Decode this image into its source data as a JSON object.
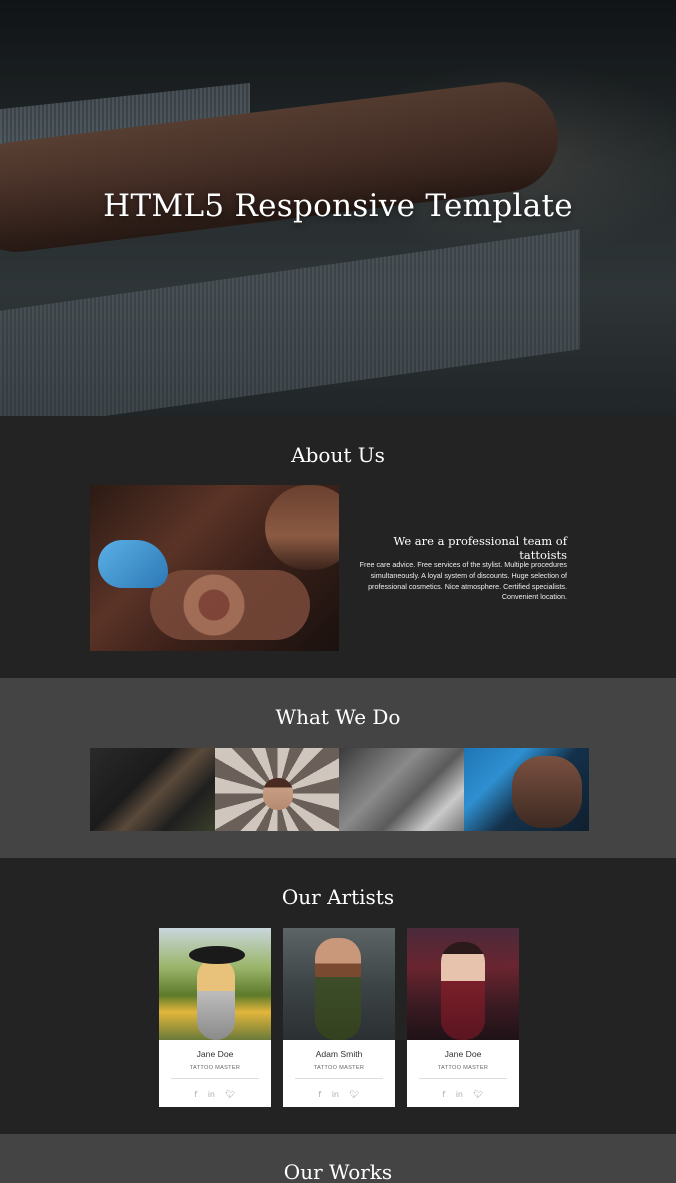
{
  "hero": {
    "title": "HTML5 Responsive Template"
  },
  "about": {
    "title": "About Us",
    "heading": "We are a professional team of tattoists",
    "text": "Free care advice. Free services of the stylist. Multiple procedures simultaneously. A loyal system of discounts. Huge selection of professional cosmetics. Nice atmosphere. Certified specialists. Convenient location."
  },
  "what_we_do": {
    "title": "What We Do"
  },
  "artists": {
    "title": "Our Artists",
    "items": [
      {
        "name": "Jane Doe",
        "role": "TATTOO MASTER"
      },
      {
        "name": "Adam Smith",
        "role": "TATTOO MASTER"
      },
      {
        "name": "Jane Doe",
        "role": "TATTOO MASTER"
      }
    ],
    "social_icons": [
      "facebook-icon",
      "linkedin-icon",
      "twitter-icon"
    ]
  },
  "works": {
    "title": "Our Works"
  },
  "colors": {
    "dark_section": "#232323",
    "mid_section": "#444444",
    "card_bg": "#ffffff"
  }
}
